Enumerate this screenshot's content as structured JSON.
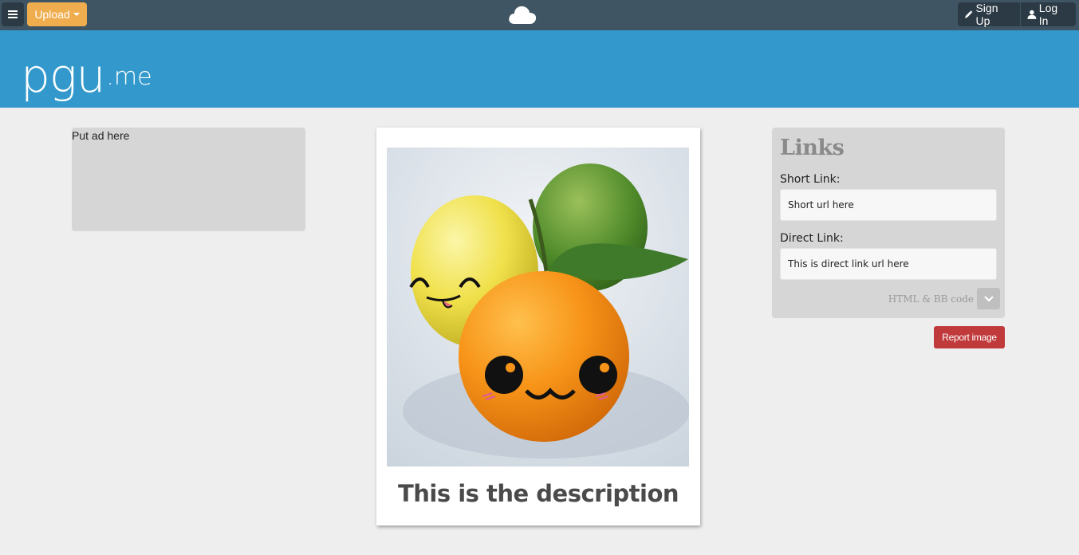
{
  "topbar": {
    "menu_icon": "hamburger-icon",
    "upload_label": "Upload",
    "center_icon": "cloud-icon",
    "signup_label": "Sign Up",
    "signup_icon": "pencil-icon",
    "login_label": "Log In",
    "login_icon": "user-icon",
    "colors": {
      "bar": "#3f5563",
      "button": "#2b3a44",
      "upload": "#f0ad4e"
    }
  },
  "header": {
    "logo_main": "pgu",
    "logo_sub": ".me",
    "color": "#3399cc"
  },
  "ad": {
    "text": "Put ad here"
  },
  "image_card": {
    "description": "This is the description"
  },
  "links": {
    "title": "Links",
    "short_link_label": "Short Link:",
    "short_link_value": "Short url here",
    "direct_link_label": "Direct Link:",
    "direct_link_value": "This is direct link url here",
    "code_toggle_label": "HTML & BB code",
    "code_toggle_icon": "chevron-down-icon"
  },
  "report": {
    "label": "Report image",
    "color": "#c0393b"
  }
}
